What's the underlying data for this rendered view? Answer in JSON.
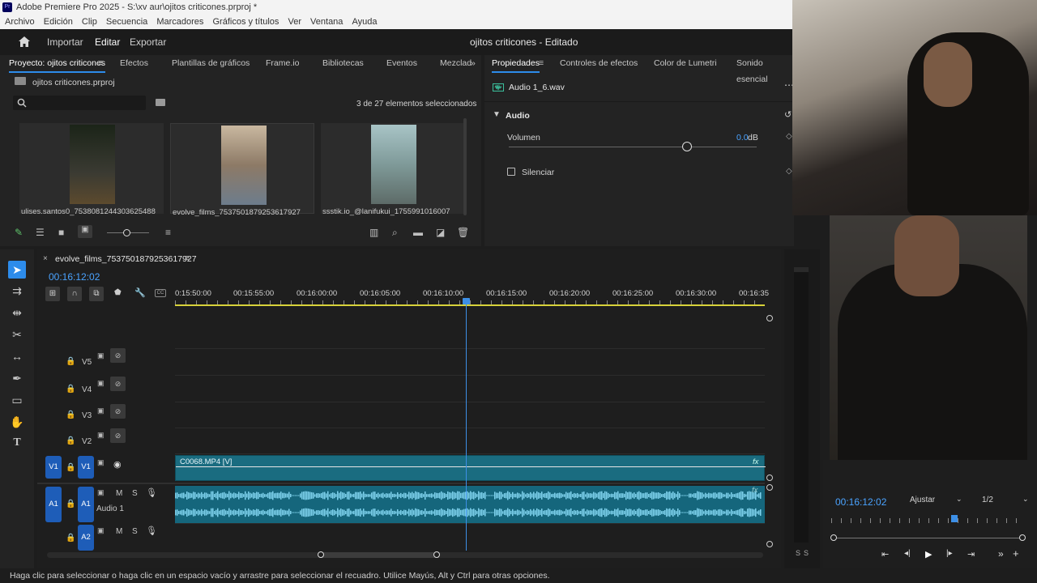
{
  "titlebar": {
    "title": "Adobe Premiere Pro 2025 - S:\\xv aur\\ojitos criticones.prproj *"
  },
  "menu": [
    "Archivo",
    "Edición",
    "Clip",
    "Secuencia",
    "Marcadores",
    "Gráficos y títulos",
    "Ver",
    "Ventana",
    "Ayuda"
  ],
  "workspace": {
    "import": "Importar",
    "edit": "Editar",
    "export": "Exportar",
    "project_title": "ojitos criticones - Editado"
  },
  "project_panel": {
    "tabs": [
      "Proyecto: ojitos criticones",
      "Efectos",
      "Plantillas de gráficos",
      "Frame.io",
      "Bibliotecas",
      "Eventos",
      "Mezclad"
    ],
    "file": "ojitos criticones.prproj",
    "search_placeholder": "",
    "selection_info": "3 de 27 elementos seleccionados",
    "items": [
      {
        "name": "ulises.santos0_7538081244303625488"
      },
      {
        "name": "evolve_films_7537501879253617927"
      },
      {
        "name": "ssstik.io_@lanifukui_1755991016007"
      }
    ]
  },
  "properties_panel": {
    "tabs": [
      "Propiedades",
      "Controles de efectos",
      "Color de Lumetri",
      "Sonido esencial"
    ],
    "clip_name": "Audio 1_6.wav",
    "section": "Audio",
    "volume_label": "Volumen",
    "volume_value": "0.0",
    "volume_unit": "dB",
    "volume_level": 0.72,
    "mute_label": "Silenciar"
  },
  "timeline": {
    "sequence_name": "evolve_films_7537501879253617927",
    "timecode": "00:16:12:02",
    "ruler": [
      "0:15:50:00",
      "00:15:55:00",
      "00:16:00:00",
      "00:16:05:00",
      "00:16:10:00",
      "00:16:15:00",
      "00:16:20:00",
      "00:16:25:00",
      "00:16:30:00",
      "00:16:35"
    ],
    "video_tracks": [
      "V5",
      "V4",
      "V3",
      "V2",
      "V1"
    ],
    "source_v1": "V1",
    "audio_tracks": [
      "A1",
      "A2"
    ],
    "source_a1": "A1",
    "audio_track_name": "Audio 1",
    "mute_letter": "M",
    "solo_letter": "S",
    "video_clip": "C0068.MP4 [V]",
    "fx": "fx"
  },
  "meter": {
    "s1": "S",
    "s2": "S"
  },
  "program_monitor": {
    "timecode": "00:16:12:02",
    "zoom": "Ajustar",
    "resolution": "1/2"
  },
  "status_bar": "Haga clic para seleccionar o haga clic en un espacio vacío y arrastre para seleccionar el recuadro. Utilice Mayús, Alt y Ctrl para otras opciones.",
  "colors": {
    "accent": "#2d8ceb",
    "clip_video": "#1f7a8c",
    "clip_audio": "#1c6f86",
    "waveform": "#7fd3ee",
    "track_btn": "#1e5db8"
  }
}
